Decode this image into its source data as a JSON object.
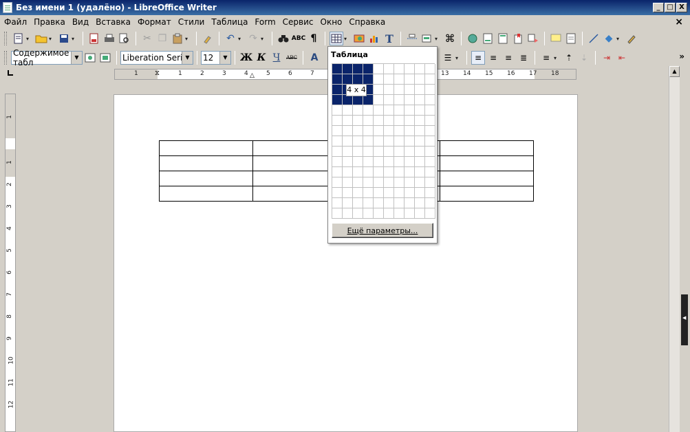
{
  "window": {
    "title": "Без имени 1 (удалёнo) - LibreOffice Writer",
    "controls": [
      "_",
      "□",
      "X"
    ],
    "doc_close": "×"
  },
  "menu": [
    "Файл",
    "Правка",
    "Вид",
    "Вставка",
    "Формат",
    "Стили",
    "Таблица",
    "Form",
    "Сервис",
    "Окно",
    "Справка"
  ],
  "format_bar": {
    "paragraph_style": "Содержимое табл",
    "font_name": "Liberation Serif",
    "font_size": "12",
    "bold": "Ж",
    "italic": "К",
    "underline": "Ч",
    "strike": "АВС",
    "overflow": "»"
  },
  "ruler": {
    "h_numbers": [
      "1",
      "1",
      "2",
      "3",
      "4",
      "5",
      "6",
      "7",
      "13",
      "14",
      "15",
      "16",
      "17",
      "18"
    ],
    "v_numbers": [
      "1",
      "1",
      "2",
      "3",
      "4",
      "5",
      "6",
      "7",
      "8",
      "9",
      "10",
      "11",
      "12"
    ]
  },
  "table_popup": {
    "title": "Таблица",
    "columns": 10,
    "rows": 15,
    "selected_columns": 4,
    "selected_rows": 4,
    "size_label": "4 x 4",
    "more_options": "Ещё параметры..."
  },
  "document": {
    "table_rows": 4,
    "table_cols": 4
  }
}
